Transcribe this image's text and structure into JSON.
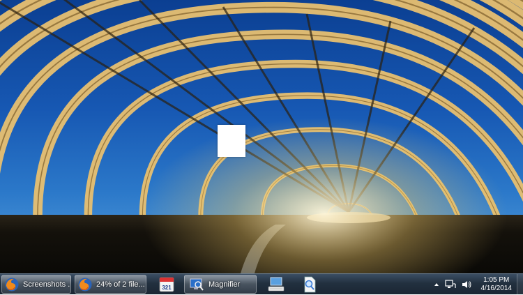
{
  "desktop": {
    "wallpaper": "steel-arch-tunnel-wallpaper",
    "sky_color": "#1a5bb5",
    "structure_color": "#e8c070"
  },
  "taskbar": {
    "items": [
      {
        "label": "Screenshots ...",
        "icon": "firefox-icon"
      },
      {
        "label": "24% of 2 file...",
        "icon": "firefox-icon"
      },
      {
        "label": "",
        "icon": "calendar-321-icon",
        "icon_text": "321"
      },
      {
        "label": "Magnifier",
        "icon": "magnifier-app-icon"
      },
      {
        "label": "",
        "icon": "computer-keyboard-icon"
      },
      {
        "label": "",
        "icon": "magnifier-document-icon"
      }
    ]
  },
  "tray": {
    "time": "1:05 PM",
    "date": "4/16/2014"
  }
}
